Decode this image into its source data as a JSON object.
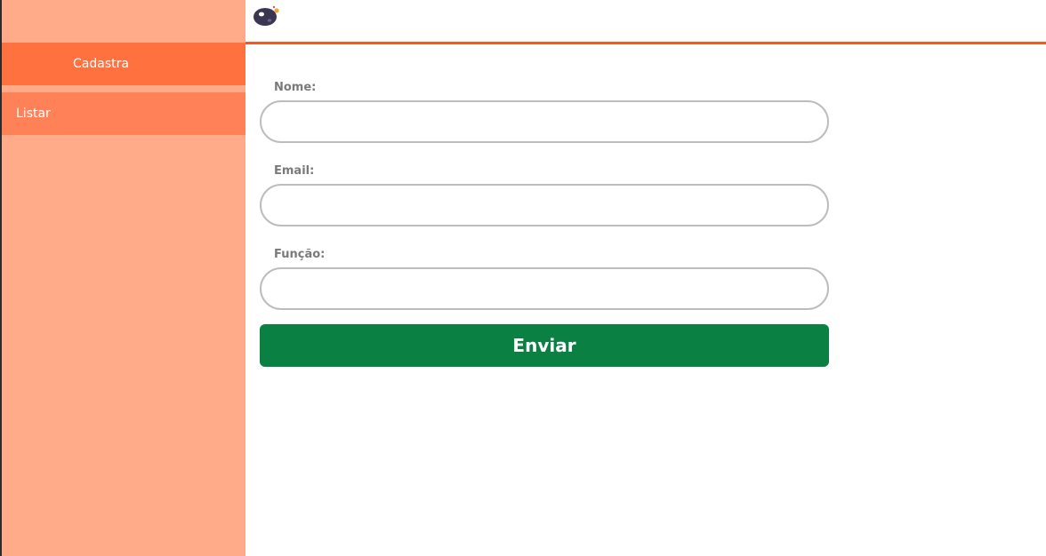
{
  "sidebar": {
    "items": [
      {
        "label": "Cadastra",
        "active": true
      },
      {
        "label": "Listar",
        "active": false
      }
    ]
  },
  "header": {
    "logo_icon": "planet-logo-icon",
    "accent_color": "#f05a24"
  },
  "form": {
    "fields": [
      {
        "label": "Nome:",
        "value": "",
        "placeholder": ""
      },
      {
        "label": "Email:",
        "value": "",
        "placeholder": ""
      },
      {
        "label": "Função:",
        "value": "",
        "placeholder": ""
      }
    ],
    "submit_label": "Enviar",
    "submit_color": "#0b8043"
  }
}
